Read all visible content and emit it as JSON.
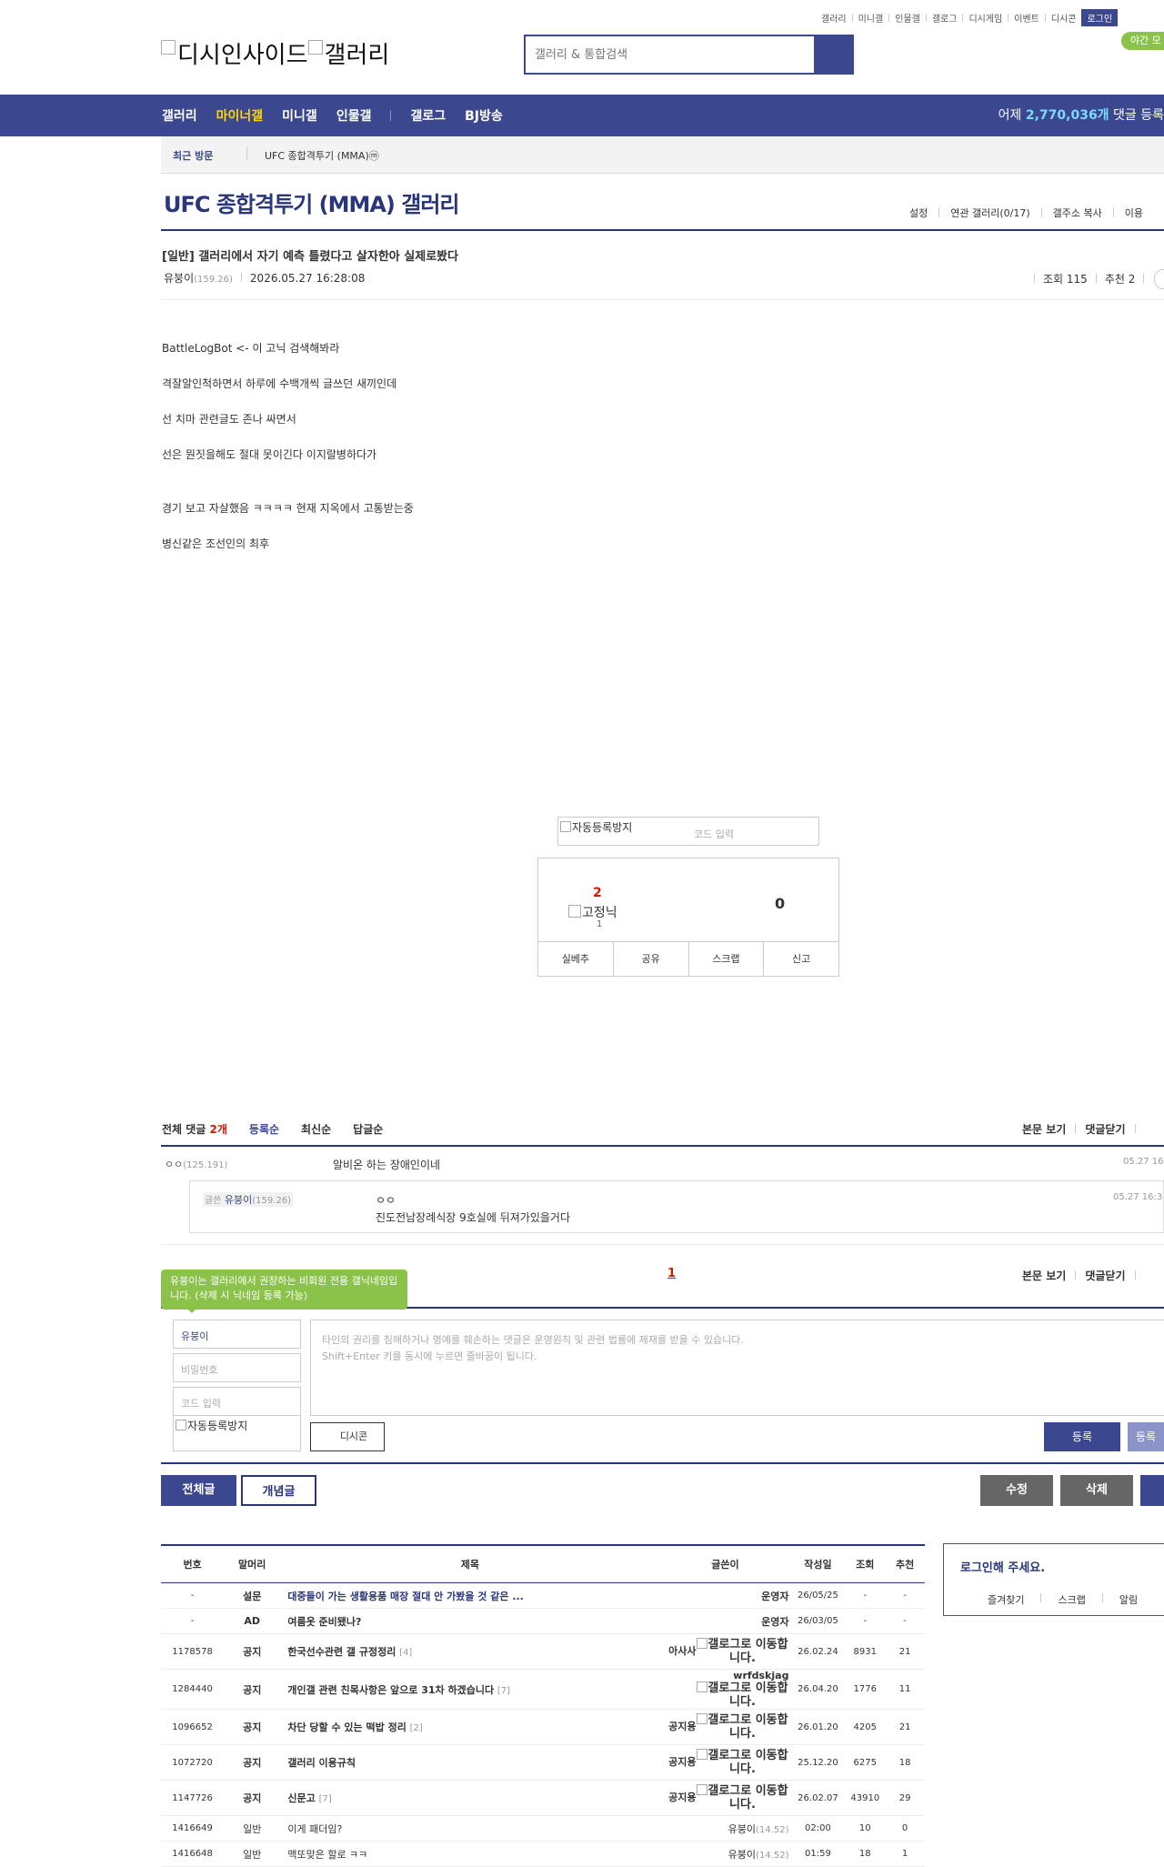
{
  "util_links": [
    "갤러리",
    "미니갤",
    "인물갤",
    "갤로그",
    "디시게임",
    "이벤트",
    "디시콘"
  ],
  "login_label": "로그인",
  "night_mode": "야간 모",
  "logo_text": "디시인사이드",
  "logo_text2": "갤러리",
  "search_placeholder": "갤러리 & 통합검색",
  "gnb": {
    "items": [
      "갤러리",
      "마이너갤",
      "미니갤",
      "인물갤"
    ],
    "items2": [
      "갤로그",
      "BJ방송"
    ],
    "stat_prefix": "어제 ",
    "stat_num": "2,770,036개",
    "stat_suffix": " 댓글 등록"
  },
  "recent": {
    "label": "최근 방문",
    "value": "UFC 종합격투기 (MMA)ⓜ"
  },
  "gallery_title": "UFC 종합격투기 (MMA) 갤러리",
  "gallery_tools": [
    "설정",
    "연관 갤러리(0/17)",
    "갤주소 복사",
    "이용"
  ],
  "post": {
    "title": "[일반] 갤러리에서 자기 예측 틀렸다고 살자한아 실제로봤다",
    "author": "유붕이",
    "ip": "(159.26)",
    "date": "2026.05.27 16:28:08",
    "views": "조회 115",
    "recommends": "추천 2",
    "body": [
      "BattleLogBot <- 이 고닉 검색해봐라",
      " 격잘알인척하면서 하루에 수백개씩 글쓰던 새끼인데",
      "선 치마 관련글도 존나 싸면서",
      "선은 뭔짓을해도 절대 못이긴다 이지랄병하다가",
      "경기 보고 자살했음 ㅋㅋㅋㅋ 현재 지옥에서 고통받는중",
      "병신같은 조선인의 최후"
    ]
  },
  "captcha": {
    "img_alt": "자동등록방지",
    "placeholder": "코드 입력"
  },
  "recommend": {
    "up_count": "2",
    "fixed_alt": "고정닉",
    "fixed_count": "1",
    "down_count": "0",
    "buttons": [
      "실베추",
      "공유",
      "스크랩",
      "신고"
    ]
  },
  "comments": {
    "label_all": "전체 댓글 ",
    "count": "2개",
    "sorts": [
      "등록순",
      "최신순",
      "답글순"
    ],
    "right": [
      "본문 보기",
      "댓글닫기"
    ],
    "c1": {
      "author": "ㅇㅇ",
      "ip": "(125.191)",
      "text": "알비온 하는 장애인이네",
      "date": "05.27 16"
    },
    "reply": {
      "tag": "글쓴",
      "author": "유붕이",
      "ip": "(159.26)",
      "line1": "ㅇㅇ",
      "line2": "진도전남장례식장 9호실에 뒤져가있을거다",
      "date": "05.27 16:3"
    },
    "page": "1"
  },
  "write": {
    "tip": "유붕이는 갤러리에서 권장하는 비회원 전용 갤닉네임입니다. (삭제 시 닉네임 등록 가능)",
    "nick": "유붕이",
    "pw_placeholder": "비밀번호",
    "code_placeholder": "코드 입력",
    "captcha_alt": "자동등록방지",
    "textarea_line1": "타인의 권리를 침해하거나 명예를 훼손하는 댓글은 운영원칙 및 관련 법률에 제재를 받을 수 있습니다.",
    "textarea_line2": "Shift+Enter 키를 동시에 누르면 줄바꿈이 됩니다.",
    "dccon": "디시콘",
    "submit": "등록",
    "submit2": "등록"
  },
  "nav": {
    "all": "전체글",
    "concept": "개념글",
    "edit": "수정",
    "delete": "삭제"
  },
  "list": {
    "headers": [
      "번호",
      "말머리",
      "제목",
      "글쓴이",
      "작성일",
      "조회",
      "추천"
    ],
    "rows": [
      {
        "no": "-",
        "head": "설문",
        "title": "대중들이 가는 생활용품 매장 절대 안 가봤을 것 같은 ...",
        "rc": "",
        "writer": "운영자",
        "ip": "",
        "badge": "",
        "date": "26/05/25",
        "views": "-",
        "rec": "-",
        "style": "survey"
      },
      {
        "no": "-",
        "head": "AD",
        "title": "여름옷 준비됐나?",
        "rc": "",
        "writer": "운영자",
        "ip": "",
        "badge": "",
        "date": "26/03/05",
        "views": "-",
        "rec": "-",
        "style": "normal"
      },
      {
        "no": "1178578",
        "head": "공지",
        "title": "한국선수관련 갤 규정정리",
        "rc": "[4]",
        "writer": "아사사",
        "ip": "",
        "badge": "갤로그로 이동합니다.",
        "date": "26.02.24",
        "views": "8931",
        "rec": "21",
        "style": "normal"
      },
      {
        "no": "1284440",
        "head": "공지",
        "title": "개인갤 관련 친목사항은 앞으로 31차 하겠습니다",
        "rc": "[7]",
        "writer": "wrfdskjag",
        "ip": "",
        "badge": "갤로그로 이동합니다.",
        "date": "26.04.20",
        "views": "1776",
        "rec": "11",
        "style": "normal"
      },
      {
        "no": "1096652",
        "head": "공지",
        "title": "차단 당할 수 있는 떡밥 정리",
        "rc": "[2]",
        "writer": "공지용",
        "ip": "",
        "badge": "갤로그로 이동합니다.",
        "date": "26.01.20",
        "views": "4205",
        "rec": "21",
        "style": "normal"
      },
      {
        "no": "1072720",
        "head": "공지",
        "title": "갤러리 이용규칙",
        "rc": "",
        "writer": "공지용",
        "ip": "",
        "badge": "갤로그로 이동합니다.",
        "date": "25.12.20",
        "views": "6275",
        "rec": "18",
        "style": "normal"
      },
      {
        "no": "1147726",
        "head": "공지",
        "title": "신문고",
        "rc": "[7]",
        "writer": "공지용",
        "ip": "",
        "badge": "갤로그로 이동합니다.",
        "date": "26.02.07",
        "views": "43910",
        "rec": "29",
        "style": "normal"
      },
      {
        "no": "1416649",
        "head": "일반",
        "title": "이게 패더임?",
        "rc": "",
        "writer": "유붕이",
        "ip": "(14.52)",
        "badge": "",
        "date": "02:00",
        "views": "10",
        "rec": "0",
        "style": "plain"
      },
      {
        "no": "1416648",
        "head": "일반",
        "title": "맥또맞은 할로 ㅋㅋ",
        "rc": "",
        "writer": "유붕이",
        "ip": "(14.52)",
        "badge": "",
        "date": "01:59",
        "views": "18",
        "rec": "1",
        "style": "plain"
      }
    ]
  },
  "loginbox": {
    "title": "로그인해 주세요.",
    "links": [
      "즐겨찾기",
      "스크랩",
      "알림"
    ]
  },
  "colors": {
    "brand": "#3b4890",
    "accent_yellow": "#ffd800",
    "green": "#8bc34a",
    "red": "#d31900"
  }
}
